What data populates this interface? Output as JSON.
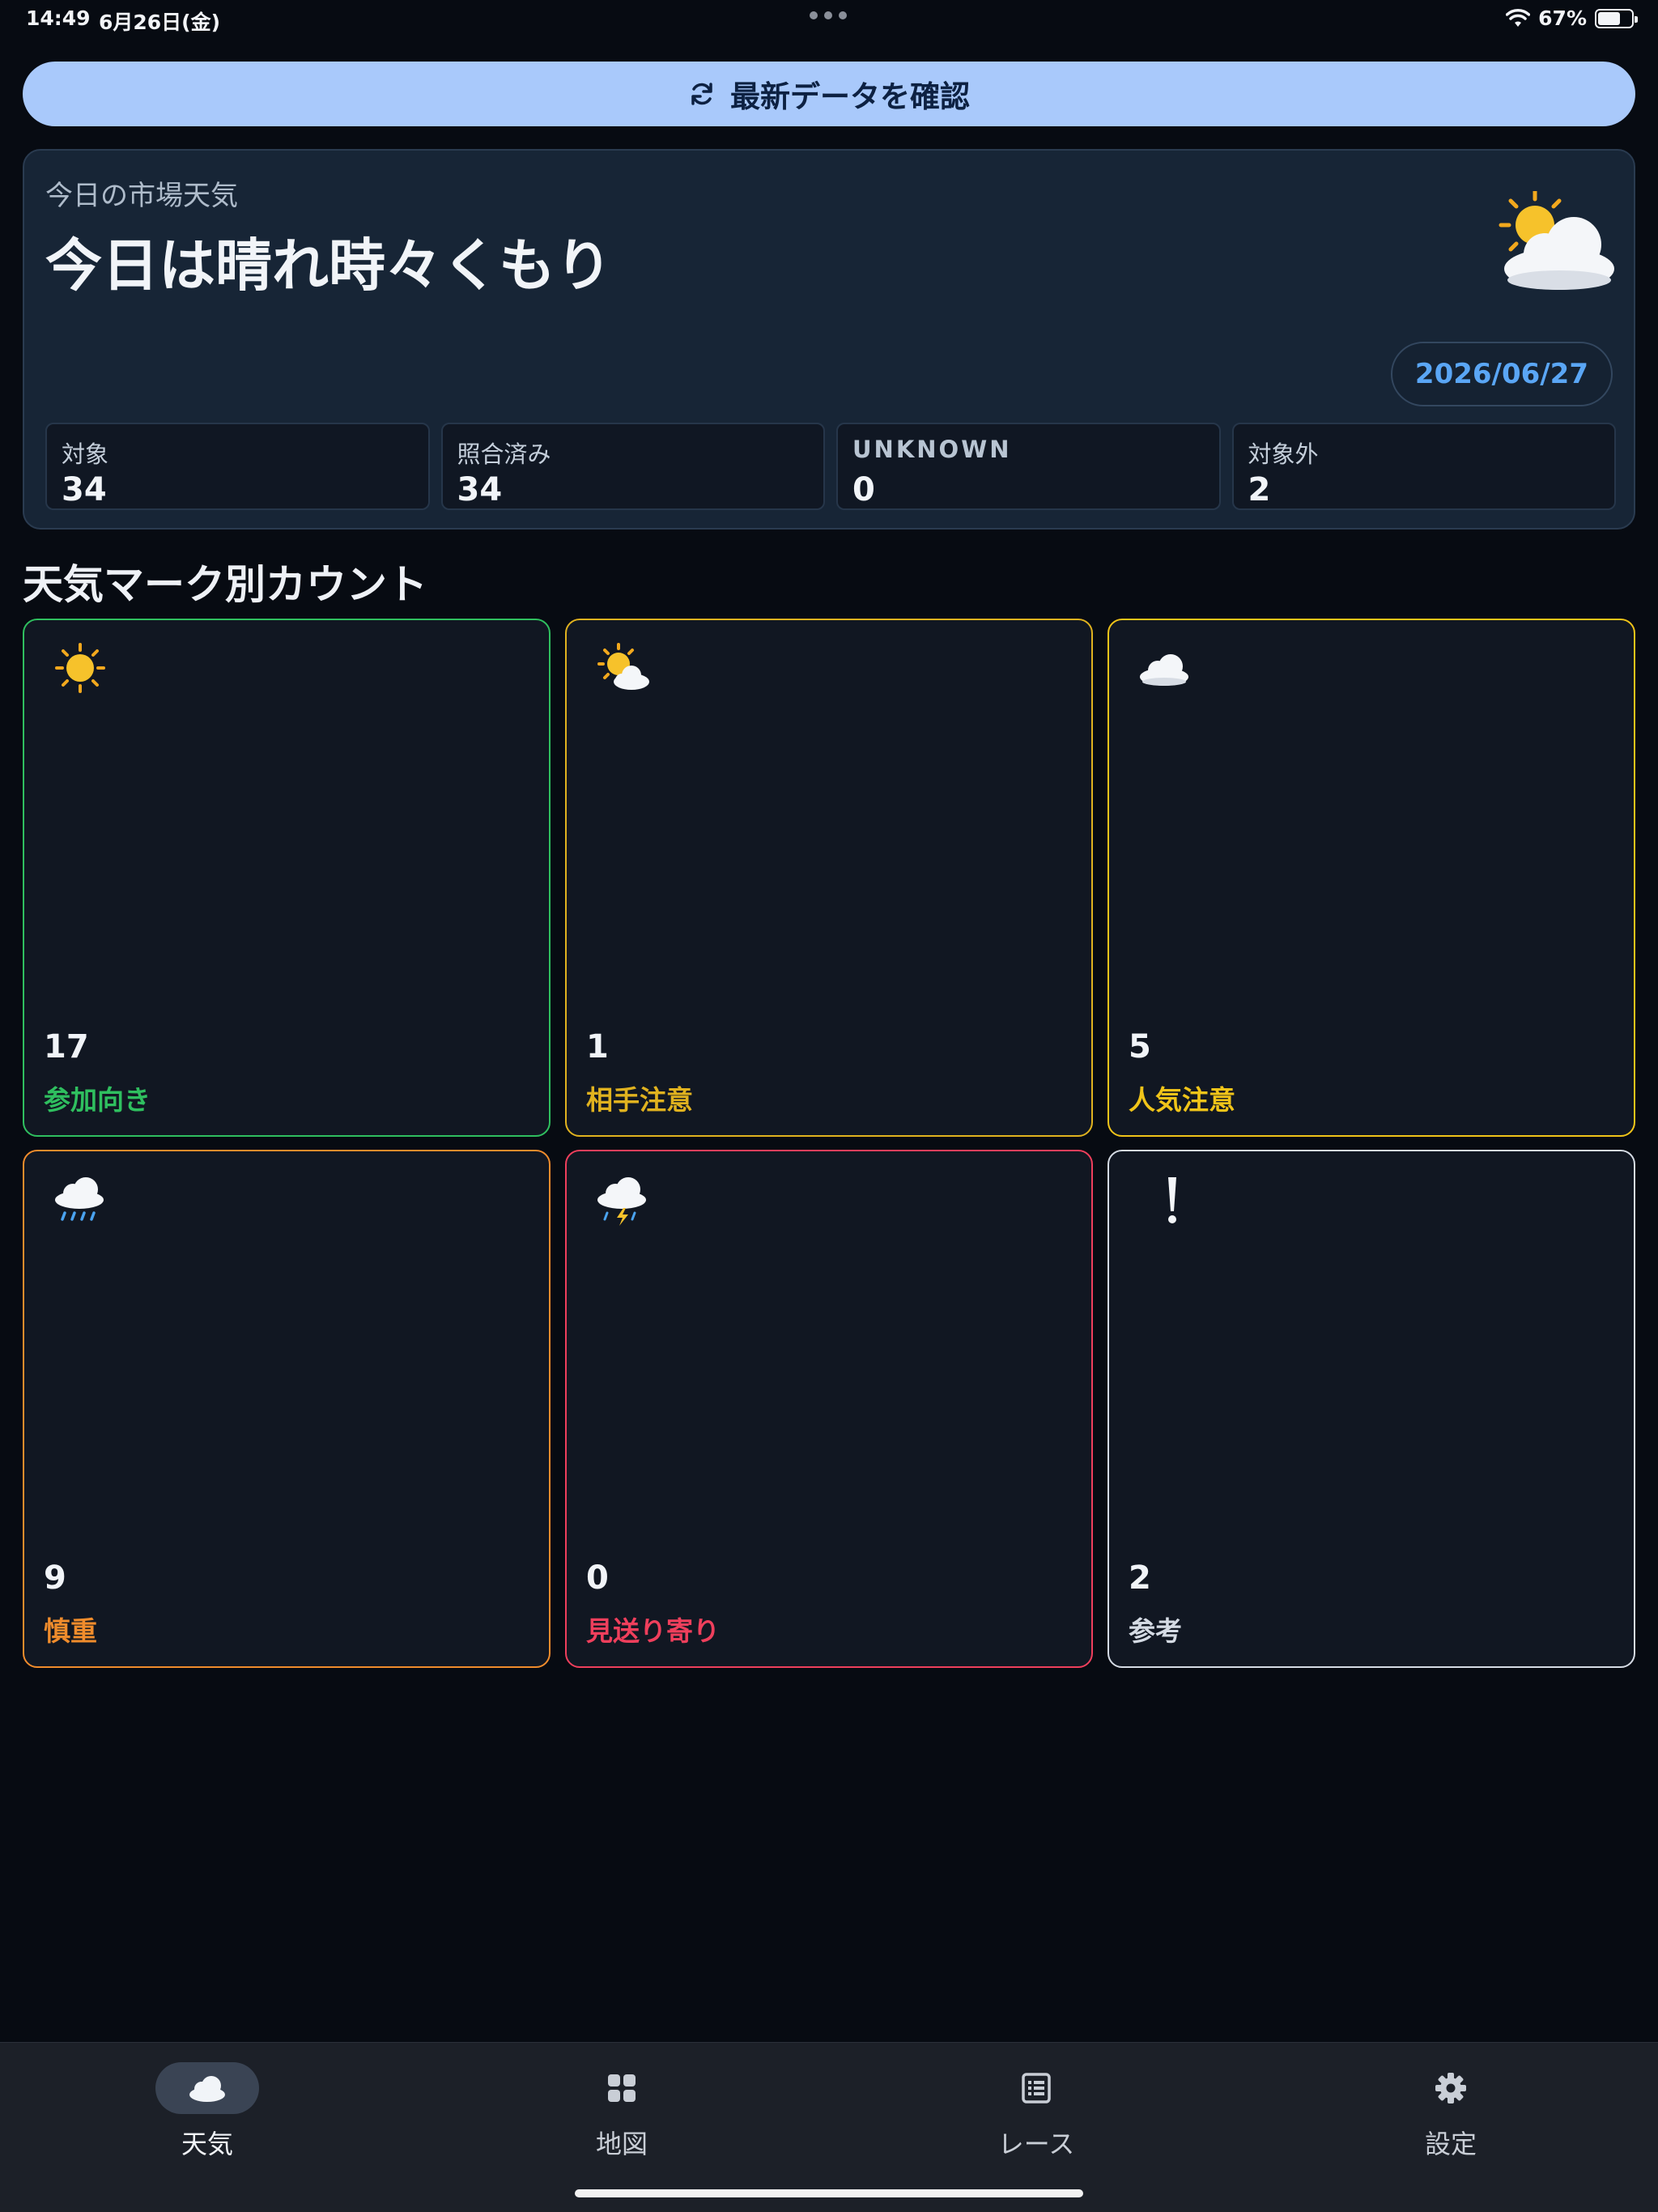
{
  "status_bar": {
    "time": "14:49",
    "date": "6月26日(金)",
    "battery_text": "67%",
    "battery_level": 0.67
  },
  "refresh": {
    "label": "最新データを確認"
  },
  "summary": {
    "kicker": "今日の市場天気",
    "headline": "今日は晴れ時々くもり",
    "icon": "sun-behind-cloud-icon",
    "date": "2026/06/27",
    "stats": [
      {
        "label": "対象",
        "value": "34"
      },
      {
        "label": "照合済み",
        "value": "34"
      },
      {
        "label": "UNKNOWN",
        "value": "0"
      },
      {
        "label": "対象外",
        "value": "2"
      }
    ]
  },
  "section_title": "天気マーク別カウント",
  "marks": [
    {
      "icon": "sun-icon",
      "count": "17",
      "label": "参加向き",
      "color": "#2fbf5f"
    },
    {
      "icon": "sun-behind-cloud-icon",
      "count": "1",
      "label": "相手注意",
      "color": "#e0b21f"
    },
    {
      "icon": "cloud-icon",
      "count": "5",
      "label": "人気注意",
      "color": "#f0c419"
    },
    {
      "icon": "cloud-rain-icon",
      "count": "9",
      "label": "慎重",
      "color": "#f08c2c"
    },
    {
      "icon": "cloud-lightning-icon",
      "count": "0",
      "label": "見送り寄り",
      "color": "#ef3f5c"
    },
    {
      "icon": "exclamation-icon",
      "count": "2",
      "label": "参考",
      "color": "#d5dbe4"
    }
  ],
  "tabs": [
    {
      "label": "天気",
      "icon": "cloud-icon",
      "active": true
    },
    {
      "label": "地図",
      "icon": "grid-icon",
      "active": false
    },
    {
      "label": "レース",
      "icon": "list-icon",
      "active": false
    },
    {
      "label": "設定",
      "icon": "gear-icon",
      "active": false
    }
  ]
}
